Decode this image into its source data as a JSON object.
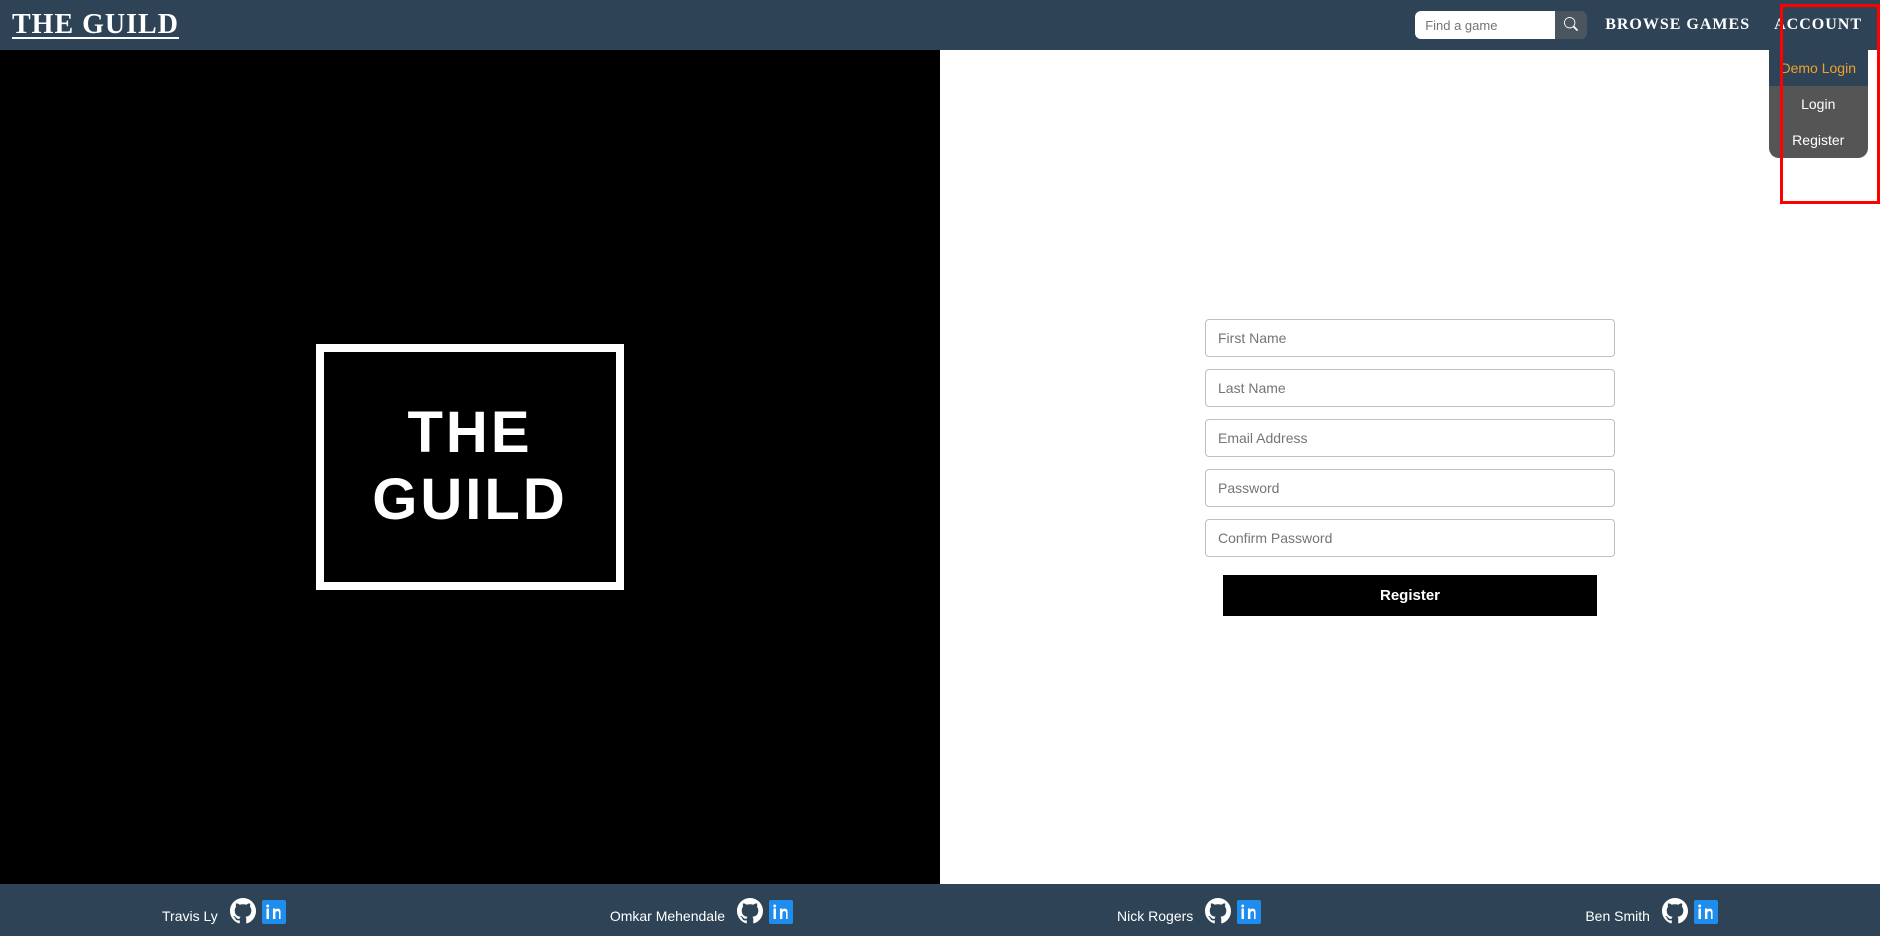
{
  "header": {
    "brand": "THE GUILD",
    "search_placeholder": "Find a game",
    "browse_label": "BROWSE GAMES",
    "account_label": "ACCOUNT",
    "dropdown": {
      "demo_login": "Demo Login",
      "login": "Login",
      "register": "Register"
    }
  },
  "hero": {
    "logo_line1": "THE",
    "logo_line2": "GUILD"
  },
  "form": {
    "first_name_placeholder": "First Name",
    "last_name_placeholder": "Last Name",
    "email_placeholder": "Email Address",
    "password_placeholder": "Password",
    "confirm_placeholder": "Confirm Password",
    "register_label": "Register"
  },
  "footer": {
    "people": [
      {
        "name": "Travis Ly"
      },
      {
        "name": "Omkar Mehendale"
      },
      {
        "name": "Nick Rogers"
      },
      {
        "name": "Ben Smith"
      }
    ]
  }
}
